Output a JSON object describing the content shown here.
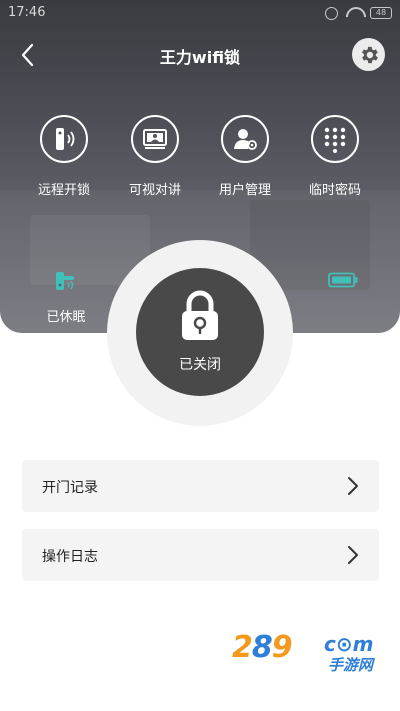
{
  "statusbar": {
    "time": "17:46",
    "battery": "48"
  },
  "header": {
    "title": "王力wifi锁",
    "back_icon": "chevron-left-icon",
    "settings_icon": "gear-icon"
  },
  "functions": [
    {
      "label": "远程开锁",
      "icon": "remote-unlock-icon"
    },
    {
      "label": "可视对讲",
      "icon": "video-intercom-icon"
    },
    {
      "label": "用户管理",
      "icon": "user-management-icon"
    },
    {
      "label": "临时密码",
      "icon": "keypad-icon"
    }
  ],
  "device_status": {
    "sleep_label": "已休眠",
    "sleep_icon": "lock-handle-icon",
    "battery_icon": "battery-full-icon",
    "accent_color": "#3fc0b8"
  },
  "lock": {
    "state_label": "已关闭",
    "icon": "padlock-icon"
  },
  "menu": [
    {
      "label": "开门记录"
    },
    {
      "label": "操作日志"
    }
  ],
  "watermark": {
    "num_orange_1": "2",
    "num_blue": "8",
    "num_orange_2": "9",
    "com": "c⊙m",
    "cn": "手游网"
  },
  "colors": {
    "hero_dark": "#3a3b40",
    "lock_button": "#494949",
    "menu_bg": "#f4f4f4"
  }
}
